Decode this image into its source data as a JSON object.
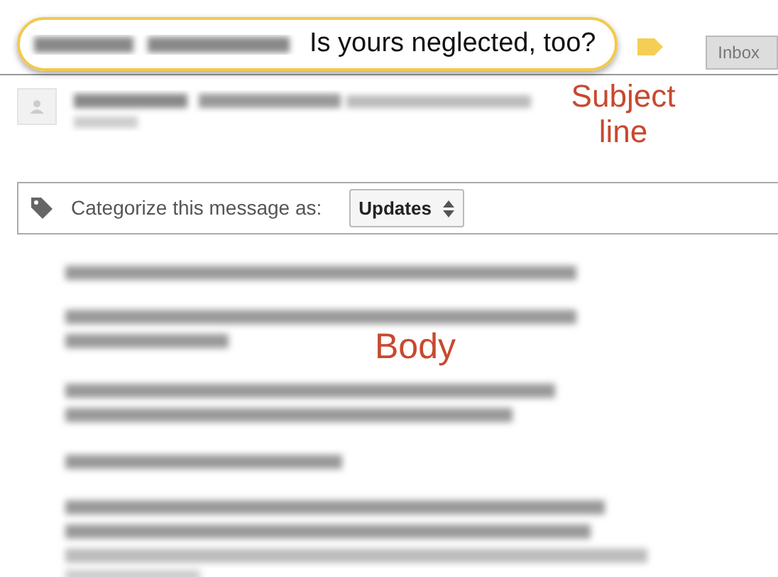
{
  "subject": {
    "text": "Is yours neglected, too?",
    "highlighted": true
  },
  "labels": [
    {
      "text": "Inbox"
    }
  ],
  "categorize": {
    "label": "Categorize this message as:",
    "value": "Updates"
  },
  "annotations": [
    {
      "kind": "subject",
      "text": "Subject line"
    },
    {
      "kind": "body",
      "text": "Body"
    }
  ]
}
